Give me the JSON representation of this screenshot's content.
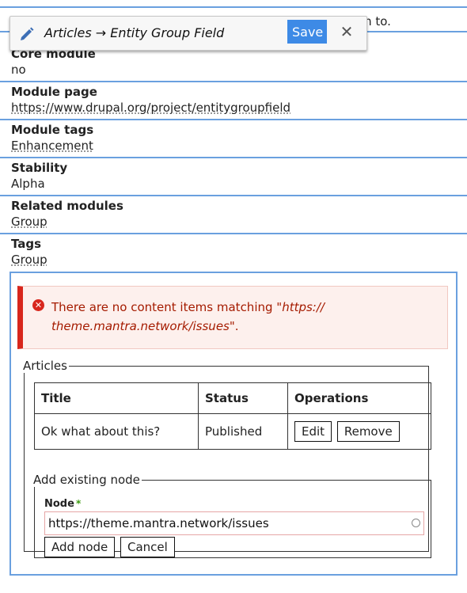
{
  "page": {
    "truncated_top_text": "m to."
  },
  "toolbar": {
    "title": "Articles → Entity Group Field",
    "save_label": "Save",
    "close_glyph": "✕"
  },
  "fields": [
    {
      "label": "Core module",
      "value": "no",
      "link": false
    },
    {
      "label": "Module page",
      "value": "https://www.drupal.org/project/entitygroupfield",
      "link": true
    },
    {
      "label": "Module tags",
      "value": "Enhancement",
      "link": true
    },
    {
      "label": "Stability",
      "value": "Alpha",
      "link": false
    },
    {
      "label": "Related modules",
      "value": "Group",
      "link": true
    },
    {
      "label": "Tags",
      "value": "Group",
      "link": true
    }
  ],
  "message": {
    "prefix": "There are no content items matching \"",
    "query": "https:// theme.mantra.network/issues",
    "suffix": "\"."
  },
  "articles": {
    "legend": "Articles",
    "columns": [
      "Title",
      "Status",
      "Operations"
    ],
    "rows": [
      {
        "title": "Ok what about this?",
        "status": "Published",
        "edit_label": "Edit",
        "remove_label": "Remove"
      }
    ]
  },
  "add_existing": {
    "legend": "Add existing node",
    "node_label": "Node",
    "required_mark": "*",
    "node_value": "https://theme.mantra.network/issues",
    "add_label": "Add node",
    "cancel_label": "Cancel"
  }
}
